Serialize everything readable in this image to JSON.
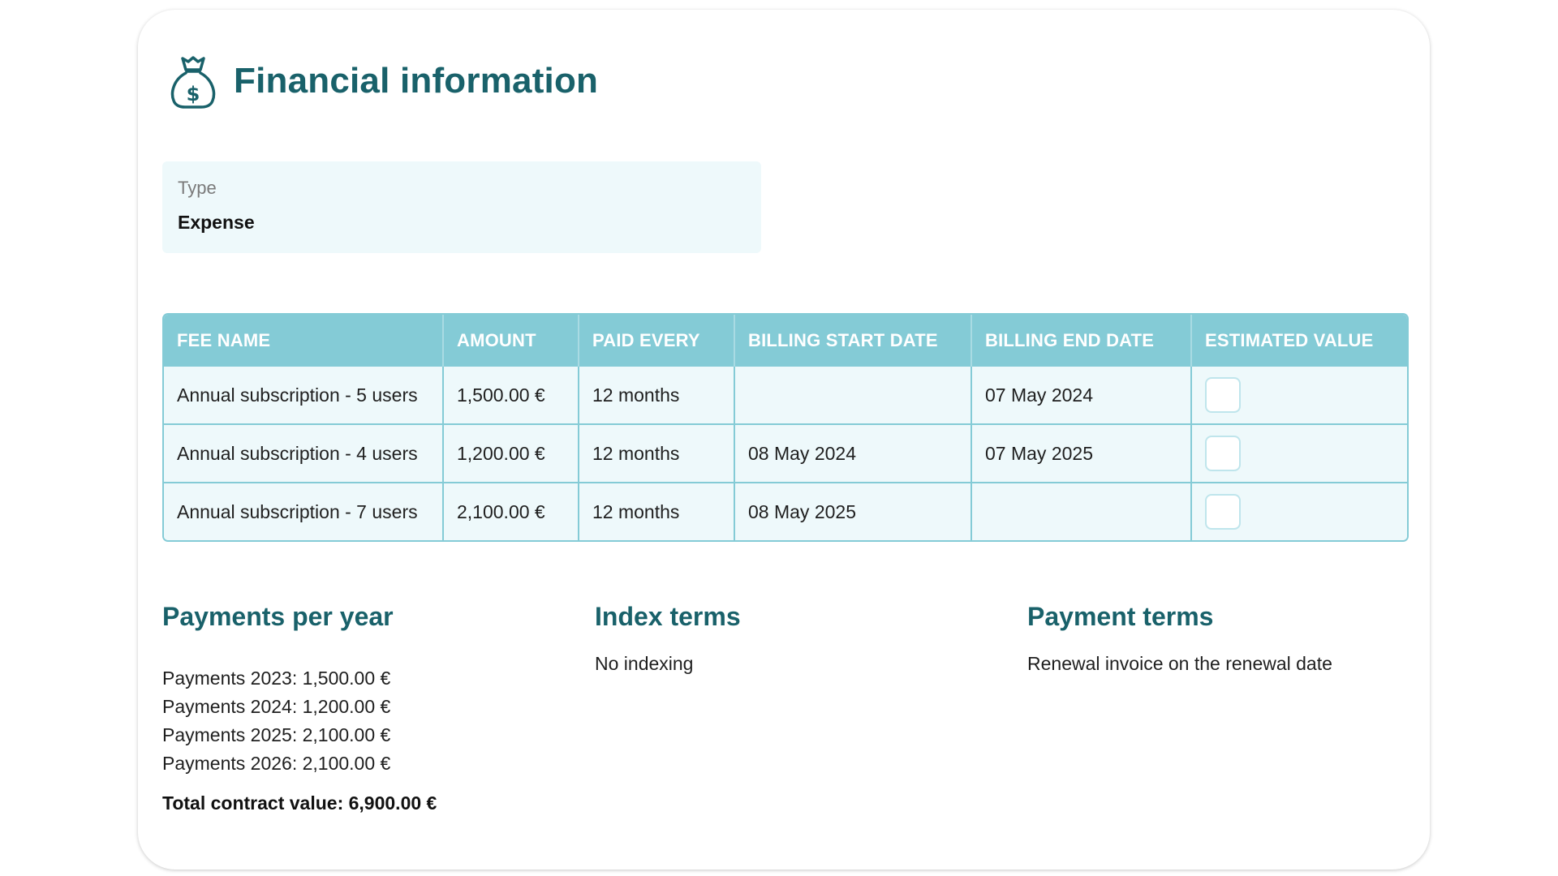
{
  "header": {
    "title": "Financial information",
    "icon": "money-bag-icon"
  },
  "type_field": {
    "label": "Type",
    "value": "Expense"
  },
  "fees_table": {
    "columns": [
      "FEE NAME",
      "AMOUNT",
      "PAID EVERY",
      "BILLING START DATE",
      "BILLING END DATE",
      "ESTIMATED VALUE"
    ],
    "rows": [
      {
        "fee_name": "Annual subscription - 5 users",
        "amount": "1,500.00 €",
        "paid_every": "12 months",
        "billing_start": "",
        "billing_end": "07 May 2024",
        "estimated": false
      },
      {
        "fee_name": "Annual subscription - 4 users",
        "amount": "1,200.00 €",
        "paid_every": "12 months",
        "billing_start": "08 May 2024",
        "billing_end": "07 May 2025",
        "estimated": false
      },
      {
        "fee_name": "Annual subscription - 7 users",
        "amount": "2,100.00 €",
        "paid_every": "12 months",
        "billing_start": "08 May 2025",
        "billing_end": "",
        "estimated": false
      }
    ]
  },
  "payments_per_year": {
    "heading": "Payments per year",
    "lines": [
      "Payments 2023: 1,500.00 €",
      "Payments 2024: 1,200.00 €",
      "Payments 2025: 2,100.00 €",
      "Payments 2026: 2,100.00 €"
    ],
    "total": "Total contract value: 6,900.00 €"
  },
  "index_terms": {
    "heading": "Index terms",
    "text": "No indexing"
  },
  "payment_terms": {
    "heading": "Payment terms",
    "text": "Renewal invoice on the renewal date"
  },
  "colors": {
    "heading": "#19616a",
    "table_header": "#84cbd6",
    "table_row": "#eef9fb"
  }
}
